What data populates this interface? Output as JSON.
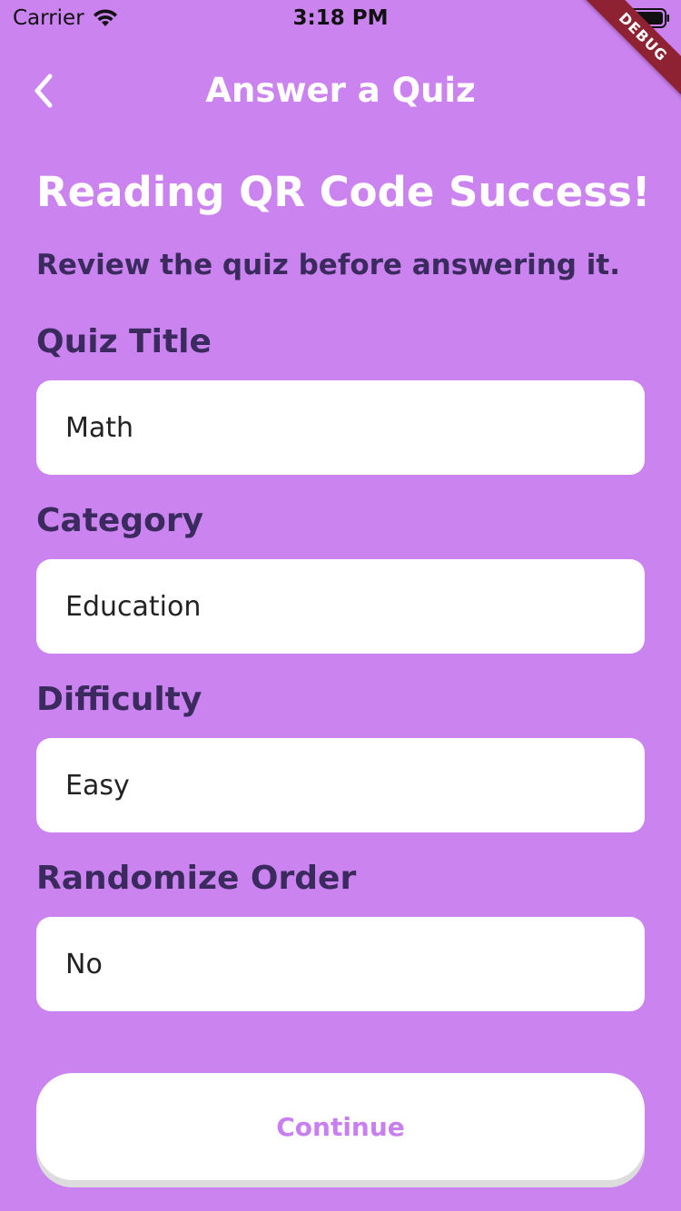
{
  "status_bar": {
    "carrier": "Carrier",
    "time": "3:18 PM",
    "wifi_icon": "wifi-icon",
    "battery_icon": "battery-full-icon"
  },
  "debug_banner": "DEBUG",
  "app_bar": {
    "back_icon": "chevron-left-icon",
    "title": "Answer a Quiz"
  },
  "main": {
    "headline": "Reading QR Code Success!",
    "subhead": "Review the quiz before answering it.",
    "fields": [
      {
        "label": "Quiz Title",
        "value": "Math"
      },
      {
        "label": "Category",
        "value": "Education"
      },
      {
        "label": "Difficulty",
        "value": "Easy"
      },
      {
        "label": "Randomize Order",
        "value": "No"
      }
    ]
  },
  "continue_button": {
    "label": "Continue"
  },
  "colors": {
    "background": "#cb83f0",
    "label_text": "#3b2a5e",
    "accent": "#c87ff0",
    "debug_ribbon": "#8e2232"
  }
}
